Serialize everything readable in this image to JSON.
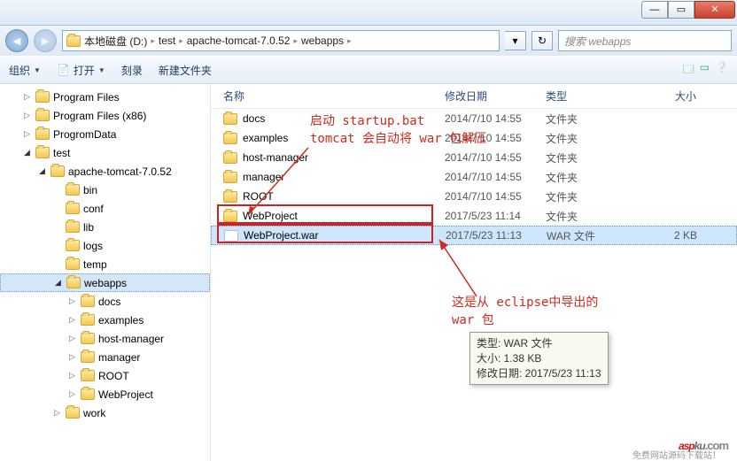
{
  "window": {
    "min": "—",
    "max": "▭",
    "close": "✕"
  },
  "breadcrumb": {
    "drive": "本地磁盘 (D:)",
    "p1": "test",
    "p2": "apache-tomcat-7.0.52",
    "p3": "webapps"
  },
  "search": {
    "placeholder": "搜索 webapps"
  },
  "toolbar": {
    "organize": "组织",
    "open": "打开",
    "burn": "刻录",
    "new_folder": "新建文件夹"
  },
  "columns": {
    "name": "名称",
    "date": "修改日期",
    "type": "类型",
    "size": "大小"
  },
  "tree": [
    {
      "label": "Program Files",
      "indent": 1,
      "triangle": "▷"
    },
    {
      "label": "Program Files (x86)",
      "indent": 1,
      "triangle": "▷"
    },
    {
      "label": "ProgromData",
      "indent": 1,
      "triangle": "▷"
    },
    {
      "label": "test",
      "indent": 1,
      "triangle": "◢"
    },
    {
      "label": "apache-tomcat-7.0.52",
      "indent": 2,
      "triangle": "◢"
    },
    {
      "label": "bin",
      "indent": 3,
      "triangle": ""
    },
    {
      "label": "conf",
      "indent": 3,
      "triangle": ""
    },
    {
      "label": "lib",
      "indent": 3,
      "triangle": ""
    },
    {
      "label": "logs",
      "indent": 3,
      "triangle": ""
    },
    {
      "label": "temp",
      "indent": 3,
      "triangle": ""
    },
    {
      "label": "webapps",
      "indent": 3,
      "triangle": "◢",
      "selected": true
    },
    {
      "label": "docs",
      "indent": 4,
      "triangle": "▷"
    },
    {
      "label": "examples",
      "indent": 4,
      "triangle": "▷"
    },
    {
      "label": "host-manager",
      "indent": 4,
      "triangle": "▷"
    },
    {
      "label": "manager",
      "indent": 4,
      "triangle": "▷"
    },
    {
      "label": "ROOT",
      "indent": 4,
      "triangle": "▷"
    },
    {
      "label": "WebProject",
      "indent": 4,
      "triangle": "▷"
    },
    {
      "label": "work",
      "indent": 3,
      "triangle": "▷"
    }
  ],
  "files": [
    {
      "name": "docs",
      "date": "2014/7/10 14:55",
      "type": "文件夹",
      "size": "",
      "icon": "folder"
    },
    {
      "name": "examples",
      "date": "2014/7/10 14:55",
      "type": "文件夹",
      "size": "",
      "icon": "folder"
    },
    {
      "name": "host-manager",
      "date": "2014/7/10 14:55",
      "type": "文件夹",
      "size": "",
      "icon": "folder"
    },
    {
      "name": "manager",
      "date": "2014/7/10 14:55",
      "type": "文件夹",
      "size": "",
      "icon": "folder"
    },
    {
      "name": "ROOT",
      "date": "2014/7/10 14:55",
      "type": "文件夹",
      "size": "",
      "icon": "folder"
    },
    {
      "name": "WebProject",
      "date": "2017/5/23 11:14",
      "type": "文件夹",
      "size": "",
      "icon": "folder"
    },
    {
      "name": "WebProject.war",
      "date": "2017/5/23 11:13",
      "type": "WAR 文件",
      "size": "2 KB",
      "icon": "war",
      "selected": true
    }
  ],
  "tooltip": {
    "l1": "类型: WAR 文件",
    "l2": "大小: 1.38 KB",
    "l3": "修改日期: 2017/5/23 11:13"
  },
  "annotations": {
    "top": "启动 startup.bat\ntomcat 会自动将 war 包解压",
    "bottom": "这是从 eclipse中导出的\nwar 包"
  },
  "watermark": {
    "asp": "asp",
    "ku": "ku",
    "com": ".com",
    "sub": "免费网站源码下载站！"
  }
}
